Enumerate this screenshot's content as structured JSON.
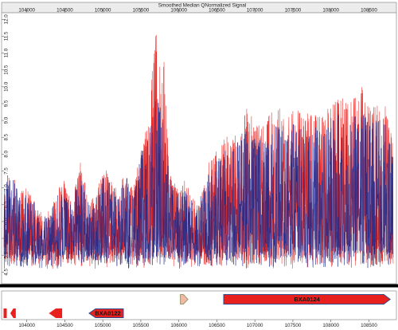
{
  "chart_data": {
    "type": "line",
    "title": "Smoothed Median QNormalized Signal",
    "xlabel": "",
    "ylabel": "",
    "xlim": [
      103700,
      108820
    ],
    "ylim": [
      4.2,
      12.15
    ],
    "x_ticks_top": [
      104000,
      104500,
      105000,
      105500,
      106000,
      106500,
      107000,
      107500,
      108000,
      108500
    ],
    "x_ticks_bottom": [
      104000,
      104500,
      105000,
      105500,
      106000,
      106500,
      107000,
      107500,
      108000,
      108500
    ],
    "y_ticks": [
      4.5,
      5.0,
      5.5,
      6.0,
      6.5,
      7.0,
      7.5,
      8.0,
      8.5,
      9.0,
      9.5,
      10.0,
      10.5,
      11.0,
      11.5,
      12.0
    ],
    "y_tick_labels": [
      "4.5",
      "5.0",
      "5.5",
      "6.0",
      "6.5",
      "7.0",
      "7.5",
      "8.0",
      "8.5",
      "9.0",
      "9.5",
      "10.0",
      "10.5",
      "11.0",
      "11.5",
      "12.0"
    ],
    "grid": false,
    "legend": "none",
    "series": [
      {
        "color": "#e8211e",
        "x": [
          103700,
          103800,
          103900,
          104000,
          104100,
          104200,
          104300,
          104400,
          104500,
          104600,
          104700,
          104800,
          104900,
          105000,
          105100,
          105200,
          105300,
          105400,
          105500,
          105600,
          105650,
          105700,
          105750,
          105800,
          105850,
          105900,
          106000,
          106100,
          106200,
          106300,
          106400,
          106500,
          106600,
          106700,
          106800,
          106900,
          107000,
          107100,
          107200,
          107300,
          107400,
          107500,
          107600,
          107700,
          107800,
          107900,
          108000,
          108100,
          108200,
          108300,
          108400,
          108500,
          108600,
          108700,
          108800
        ],
        "y": [
          7.3,
          7.6,
          6.9,
          7.0,
          6.8,
          6.2,
          6.4,
          6.9,
          7.3,
          6.6,
          7.8,
          6.8,
          6.7,
          7.6,
          7.5,
          6.8,
          7.6,
          6.9,
          8.3,
          9.1,
          10.5,
          11.8,
          11.6,
          11.3,
          8.7,
          7.3,
          7.0,
          7.3,
          6.6,
          6.9,
          7.9,
          8.1,
          8.6,
          8.4,
          8.8,
          9.4,
          8.9,
          8.8,
          9.2,
          9.6,
          9.0,
          9.5,
          9.3,
          9.2,
          9.3,
          9.2,
          9.5,
          9.8,
          9.6,
          9.7,
          10.1,
          9.4,
          9.5,
          9.6,
          8.6
        ]
      },
      {
        "color": "#1f2a8c",
        "x": [
          103700,
          103800,
          103900,
          104000,
          104100,
          104200,
          104300,
          104400,
          104500,
          104600,
          104700,
          104800,
          104900,
          105000,
          105100,
          105200,
          105300,
          105400,
          105500,
          105600,
          105650,
          105700,
          105750,
          105800,
          105850,
          105900,
          106000,
          106100,
          106200,
          106300,
          106400,
          106500,
          106600,
          106700,
          106800,
          106900,
          107000,
          107100,
          107200,
          107300,
          107400,
          107500,
          107600,
          107700,
          107800,
          107900,
          108000,
          108100,
          108200,
          108300,
          108400,
          108500,
          108600,
          108700,
          108800
        ],
        "y": [
          7.1,
          7.4,
          6.8,
          6.9,
          6.6,
          6.1,
          6.3,
          6.8,
          7.1,
          6.5,
          7.6,
          6.6,
          6.6,
          7.4,
          7.4,
          6.7,
          7.4,
          6.7,
          8.0,
          8.7,
          9.4,
          9.8,
          9.5,
          9.0,
          8.1,
          7.1,
          6.9,
          7.1,
          6.5,
          6.8,
          7.6,
          7.8,
          8.2,
          8.1,
          8.5,
          9.0,
          8.5,
          8.4,
          8.7,
          9.0,
          8.6,
          8.9,
          8.8,
          8.7,
          8.8,
          8.7,
          9.0,
          9.2,
          9.0,
          9.1,
          9.3,
          8.9,
          9.0,
          9.1,
          8.2
        ]
      }
    ]
  },
  "gene_track": {
    "genes": [
      {
        "name": "",
        "start": 103700,
        "end": 103720,
        "strand": "+",
        "color": "#e8211e",
        "outline": "#e8211e",
        "lane": "low"
      },
      {
        "name": "",
        "start": 103790,
        "end": 103850,
        "strand": "-",
        "color": "#e8211e",
        "outline": "#e8211e",
        "lane": "low"
      },
      {
        "name": "",
        "start": 104300,
        "end": 104460,
        "strand": "-",
        "color": "#e8211e",
        "outline": "#e8211e",
        "lane": "low"
      },
      {
        "name": "BXA0122",
        "start": 104820,
        "end": 105270,
        "strand": "-",
        "color": "#e8211e",
        "outline": "#2f4a8a",
        "lane": "low"
      },
      {
        "name": "",
        "start": 106020,
        "end": 106120,
        "strand": "+",
        "color": "#f2b8a8",
        "outline": "#9a9a6a",
        "lane": "high"
      },
      {
        "name": "BXA0124",
        "start": 106590,
        "end": 108780,
        "strand": "+",
        "color": "#e8211e",
        "outline": "#2f4a8a",
        "lane": "high"
      }
    ]
  }
}
